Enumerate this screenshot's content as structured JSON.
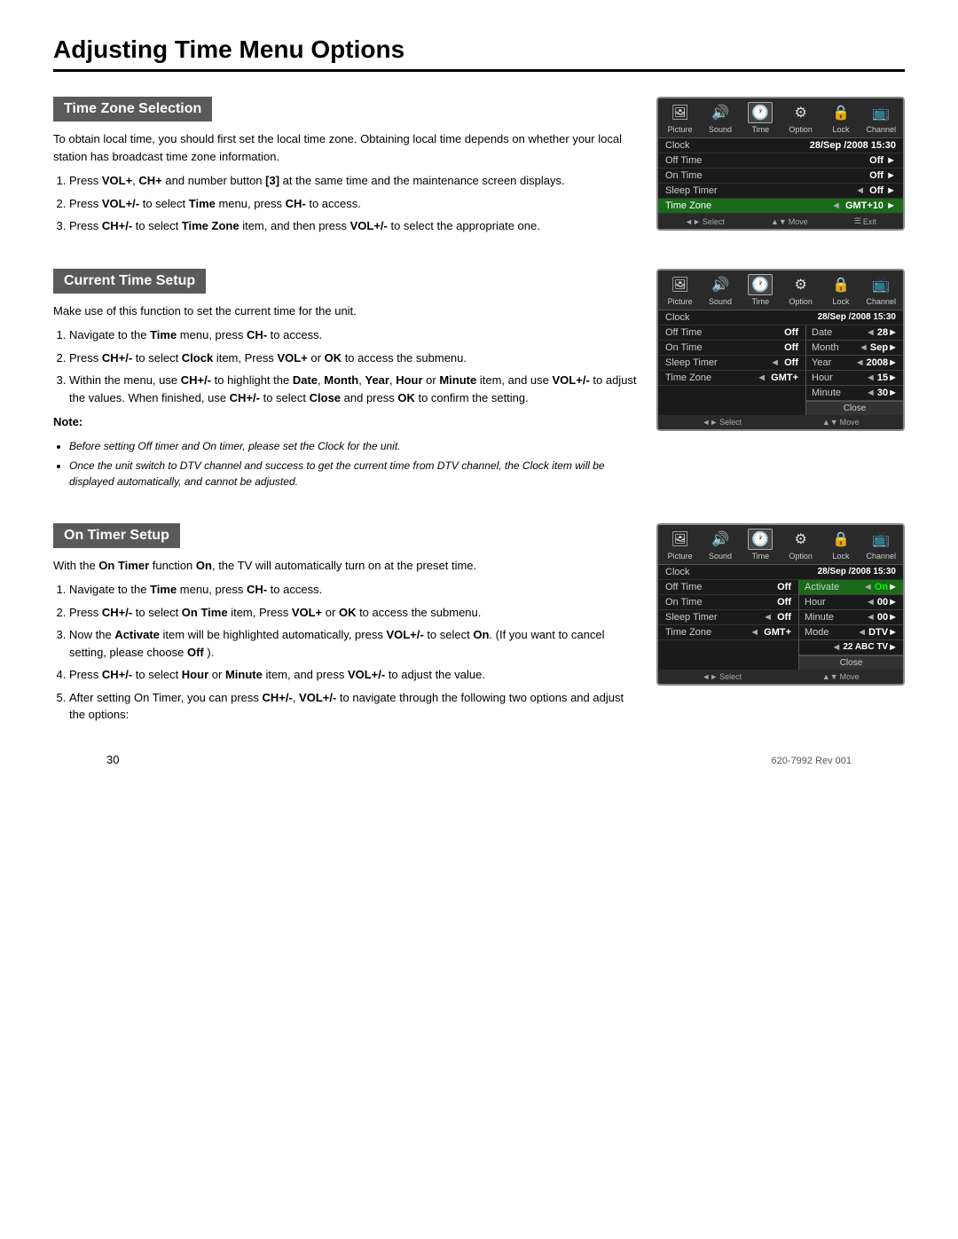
{
  "page": {
    "title": "Adjusting Time Menu Options",
    "footer_page": "30",
    "footer_revision": "620-7992 Rev 001"
  },
  "sections": [
    {
      "id": "time-zone",
      "heading": "Time Zone Selection",
      "paragraphs": [
        "To obtain local time, you should first set the local time zone. Obtaining local time depends on whether your local station has broadcast time zone information."
      ],
      "steps": [
        "Press VOL+, CH+ and number button [3] at the same time and the maintenance screen displays.",
        "Press VOL+/- to select Time menu, press CH- to access.",
        "Press CH+/- to select Time Zone item, and then press VOL+/- to select the appropriate one."
      ],
      "notes": [],
      "screen": {
        "icons": [
          "Picture",
          "Sound",
          "Time",
          "Option",
          "Lock",
          "Channel"
        ],
        "active_icon": 2,
        "menu_rows": [
          {
            "label": "Clock",
            "value": "28/Sep /2008 15:30",
            "active": false
          },
          {
            "label": "Off Time",
            "value": "Off",
            "arrow_right": true,
            "active": false
          },
          {
            "label": "On Time",
            "value": "Off",
            "arrow_right": true,
            "active": false
          },
          {
            "label": "Sleep Timer",
            "value": "Off",
            "arrow_left": true,
            "arrow_right": true,
            "active": false
          },
          {
            "label": "Time Zone",
            "value": "GMT+10",
            "arrow_left": true,
            "arrow_right": true,
            "active": true
          }
        ],
        "footer": [
          {
            "icon": "◄►",
            "label": "Select"
          },
          {
            "icon": "▲▼",
            "label": "Move"
          },
          {
            "icon": "Menu",
            "label": "Exit"
          }
        ]
      }
    },
    {
      "id": "current-time",
      "heading": "Current Time Setup",
      "paragraphs": [
        "Make use of this function to set the current time for the unit."
      ],
      "steps": [
        "Navigate to the Time menu, press CH- to access.",
        "Press CH+/- to select Clock item, Press VOL+ or OK to access the submenu.",
        "Within the menu, use CH+/- to highlight the Date, Month, Year, Hour or Minute item, and use VOL+/- to adjust the values. When finished, use CH+/- to select Close and press OK to confirm the setting."
      ],
      "note_label": "Note:",
      "notes": [
        "Before setting Off timer and On timer, please set the Clock for the unit.",
        "Once the unit switch to DTV channel and success to get the current time from DTV channel, the Clock item will be displayed automatically, and cannot be adjusted."
      ],
      "screen": {
        "icons": [
          "Picture",
          "Sound",
          "Time",
          "Option",
          "Lock",
          "Channel"
        ],
        "active_icon": 2,
        "menu_rows": [
          {
            "label": "Clock",
            "value": "28/Sep /2008 15:30",
            "active": false
          },
          {
            "label": "Off Time",
            "value": "Off",
            "active": false
          },
          {
            "label": "On Time",
            "value": "Off",
            "active": false
          },
          {
            "label": "Sleep Timer",
            "value": "Off",
            "arrow_left": true,
            "active": false
          },
          {
            "label": "Time Zone",
            "value": "GMT+",
            "arrow_left": true,
            "active": false
          }
        ],
        "submenu": [
          {
            "label": "Date",
            "value": "28",
            "arrow_left": true,
            "arrow_right": true
          },
          {
            "label": "Month",
            "value": "Sep",
            "arrow_left": true,
            "arrow_right": true
          },
          {
            "label": "Year",
            "value": "2008",
            "arrow_left": true,
            "arrow_right": true
          },
          {
            "label": "Hour",
            "value": "15",
            "arrow_left": true,
            "arrow_right": true
          },
          {
            "label": "Minute",
            "value": "30",
            "arrow_left": true,
            "arrow_right": true
          }
        ],
        "footer": [
          {
            "icon": "◄►",
            "label": "Select"
          },
          {
            "icon": "▲▼",
            "label": "Move"
          }
        ]
      }
    },
    {
      "id": "on-timer",
      "heading": "On Timer Setup",
      "paragraphs": [
        "With the On Timer function On, the TV will automatically turn on at the preset time."
      ],
      "steps": [
        "Navigate to the Time menu, press CH- to access.",
        "Press CH+/- to select On Time item, Press VOL+ or OK to access the submenu.",
        "Now the Activate item will be highlighted automatically, press VOL+/- to select On. (If you want to cancel setting, please choose Off ).",
        "Press CH+/- to select Hour or Minute item, and press VOL+/- to adjust the value.",
        "After setting On Timer, you can press CH+/-, VOL+/- to navigate through the following two options and adjust the options:"
      ],
      "notes": [],
      "screen": {
        "icons": [
          "Picture",
          "Sound",
          "Time",
          "Option",
          "Lock",
          "Channel"
        ],
        "active_icon": 2,
        "menu_rows": [
          {
            "label": "Clock",
            "value": "28/Sep /2008 15:30",
            "active": false
          },
          {
            "label": "Off Time",
            "value": "Off",
            "active": false
          },
          {
            "label": "On Time",
            "value": "Off",
            "active": false
          },
          {
            "label": "Sleep Timer",
            "value": "Off",
            "arrow_left": true,
            "active": false
          },
          {
            "label": "Time Zone",
            "value": "GMT+",
            "arrow_left": true,
            "active": false
          }
        ],
        "submenu": [
          {
            "label": "Activate",
            "value": "On",
            "arrow_left": true,
            "arrow_right": true,
            "active": true
          },
          {
            "label": "Hour",
            "value": "00",
            "arrow_left": true,
            "arrow_right": true
          },
          {
            "label": "Minute",
            "value": "00",
            "arrow_left": true,
            "arrow_right": true
          },
          {
            "label": "Mode",
            "value": "DTV",
            "arrow_left": true,
            "arrow_right": true
          },
          {
            "label": "",
            "value": "22 ABC TV",
            "arrow_left": true,
            "arrow_right": true
          }
        ],
        "footer": [
          {
            "icon": "◄►",
            "label": "Select"
          },
          {
            "icon": "▲▼",
            "label": "Move"
          }
        ]
      }
    }
  ]
}
